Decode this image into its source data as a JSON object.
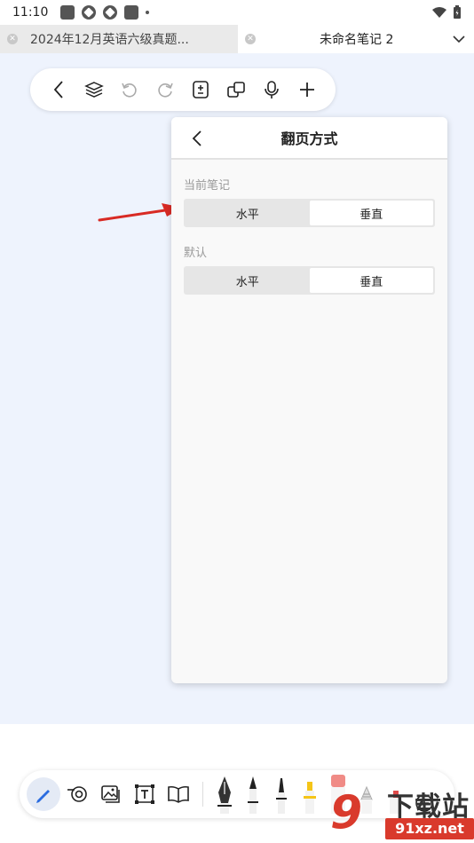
{
  "status_bar": {
    "time": "11:10"
  },
  "tabs": [
    {
      "label": "2024年12月英语六级真题...",
      "active": false
    },
    {
      "label": "未命名笔记 2",
      "active": true
    }
  ],
  "top_toolbar": {
    "icons": [
      "back-icon",
      "layers-icon",
      "undo-icon",
      "redo-icon",
      "page-icon",
      "copy-icon",
      "mic-icon",
      "plus-icon"
    ]
  },
  "panel": {
    "title": "翻页方式",
    "sections": [
      {
        "label": "当前笔记",
        "options": [
          "水平",
          "垂直"
        ],
        "selected": "垂直"
      },
      {
        "label": "默认",
        "options": [
          "水平",
          "垂直"
        ],
        "selected": "垂直"
      }
    ]
  },
  "bottom_toolbar": {
    "tools": [
      "pen-icon",
      "eraser-icon",
      "image-icon",
      "text-icon",
      "book-icon"
    ],
    "pens": [
      "fountain-pen-icon",
      "ballpoint-pen-icon",
      "marker-icon",
      "highlighter-icon",
      "pink-marker-icon",
      "pencil-icon",
      "red-pen-icon",
      "add-pen-icon"
    ]
  },
  "watermark": {
    "number": "9",
    "title": "下载站",
    "url": "91xz.net"
  },
  "colors": {
    "accent": "#2b6ce0",
    "arrow": "#d82a24",
    "background": "#eef3fd"
  }
}
